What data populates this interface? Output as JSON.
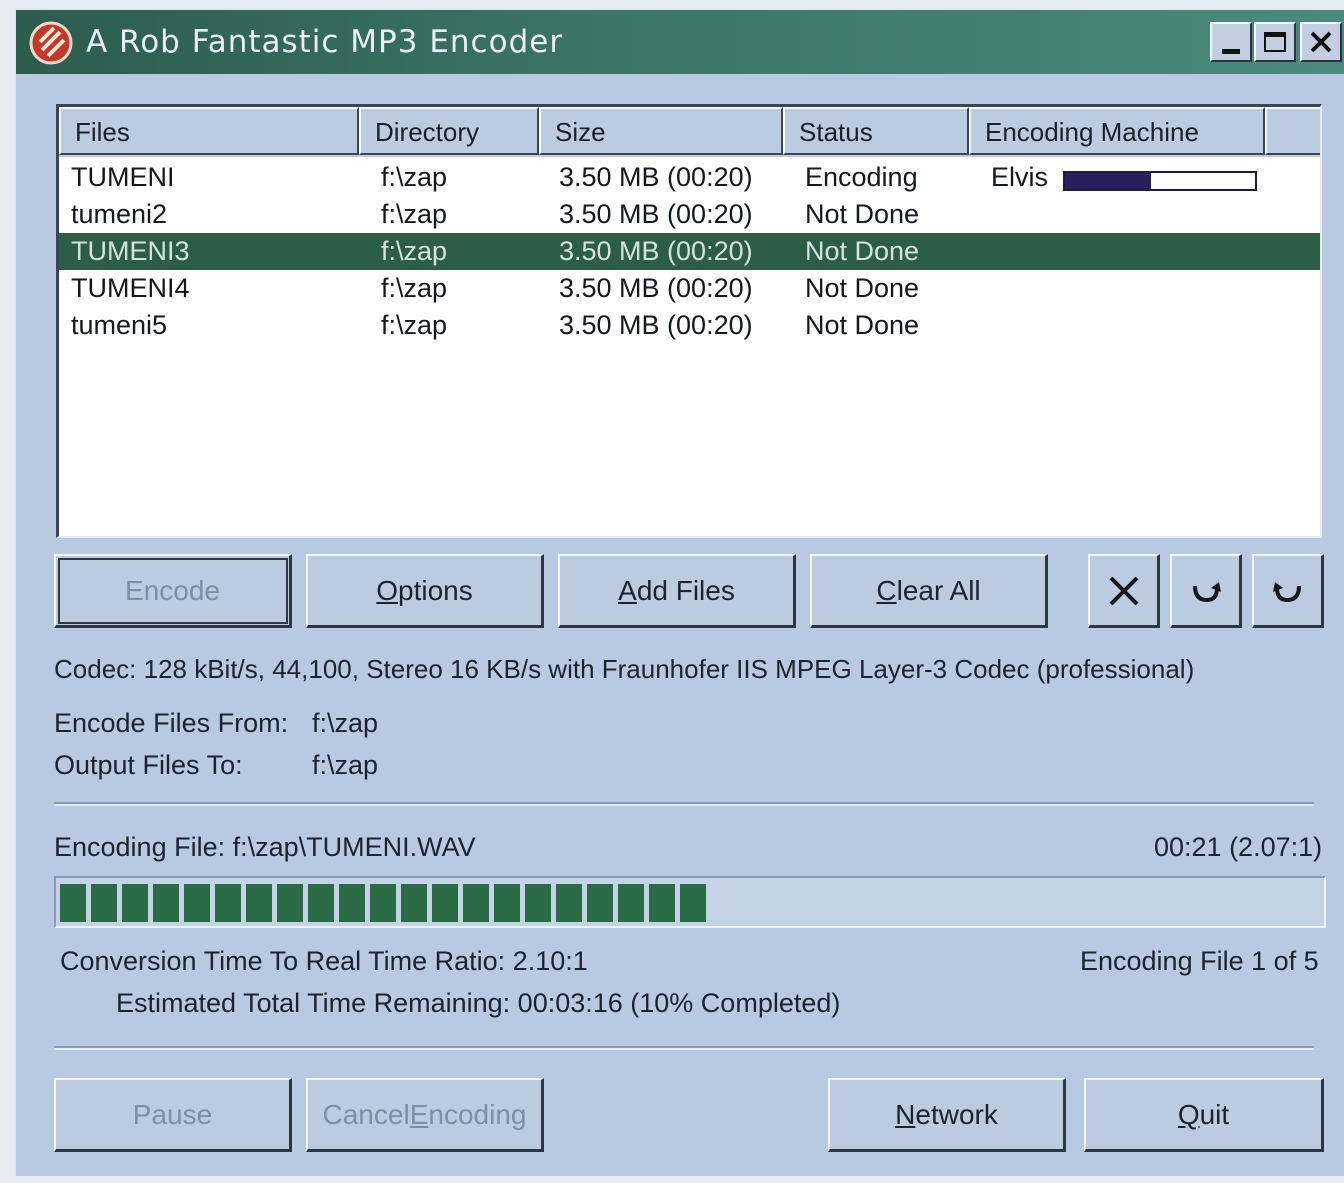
{
  "window": {
    "title": "A Rob Fantastic MP3 Encoder",
    "controls": [
      "minimize-icon",
      "maximize-icon",
      "close-icon"
    ]
  },
  "list": {
    "columns": [
      "Files",
      "Directory",
      "Size",
      "Status",
      "Encoding Machine"
    ],
    "rows": [
      {
        "file": "TUMENI",
        "dir": "f:\\zap",
        "size": "3.50 MB (00:20)",
        "status": "Encoding",
        "machine": "Elvis",
        "progress": 0.45
      },
      {
        "file": "tumeni2",
        "dir": "f:\\zap",
        "size": "3.50 MB (00:20)",
        "status": "Not Done",
        "machine": ""
      },
      {
        "file": "TUMENI3",
        "dir": "f:\\zap",
        "size": "3.50 MB (00:20)",
        "status": "Not Done",
        "machine": "",
        "selected": true
      },
      {
        "file": "TUMENI4",
        "dir": "f:\\zap",
        "size": "3.50 MB (00:20)",
        "status": "Not Done",
        "machine": ""
      },
      {
        "file": "tumeni5",
        "dir": "f:\\zap",
        "size": "3.50 MB (00:20)",
        "status": "Not Done",
        "machine": ""
      }
    ]
  },
  "toolbar": {
    "encode": "Encode",
    "options_mn": "O",
    "options_rest": "ptions",
    "add_mn": "A",
    "add_rest": "dd Files",
    "clear_mn": "C",
    "clear_rest": "lear All",
    "icons": [
      "remove-icon",
      "move-down-icon",
      "move-up-icon"
    ]
  },
  "info": {
    "codec": "Codec: 128 kBit/s, 44,100, Stereo  16 KB/s with Fraunhofer IIS MPEG Layer-3 Codec (professional)",
    "from_label": "Encode Files From:",
    "from_value": "f:\\zap",
    "to_label": "Output Files To:",
    "to_value": "f:\\zap"
  },
  "encoding": {
    "file": "Encoding File: f:\\zap\\TUMENI.WAV",
    "time": "00:21 (2.07:1)",
    "segments_filled": 21,
    "segments_total": 40,
    "ratio": "Conversion Time To Real Time Ratio: 2.10:1",
    "count": "Encoding File 1 of 5",
    "remaining": "Estimated Total Time Remaining: 00:03:16  (10% Completed)"
  },
  "bottom": {
    "pause": "Pause",
    "cancel_pre": "Cancel ",
    "cancel_mn": "E",
    "cancel_rest": "ncoding",
    "network_mn": "N",
    "network_rest": "etwork",
    "quit_mn": "Q",
    "quit_rest": "uit"
  },
  "colors": {
    "title_bar": "#2c5d4e",
    "selection": "#2c5d47",
    "progress": "#2a6a45",
    "face": "#bccbe0"
  }
}
